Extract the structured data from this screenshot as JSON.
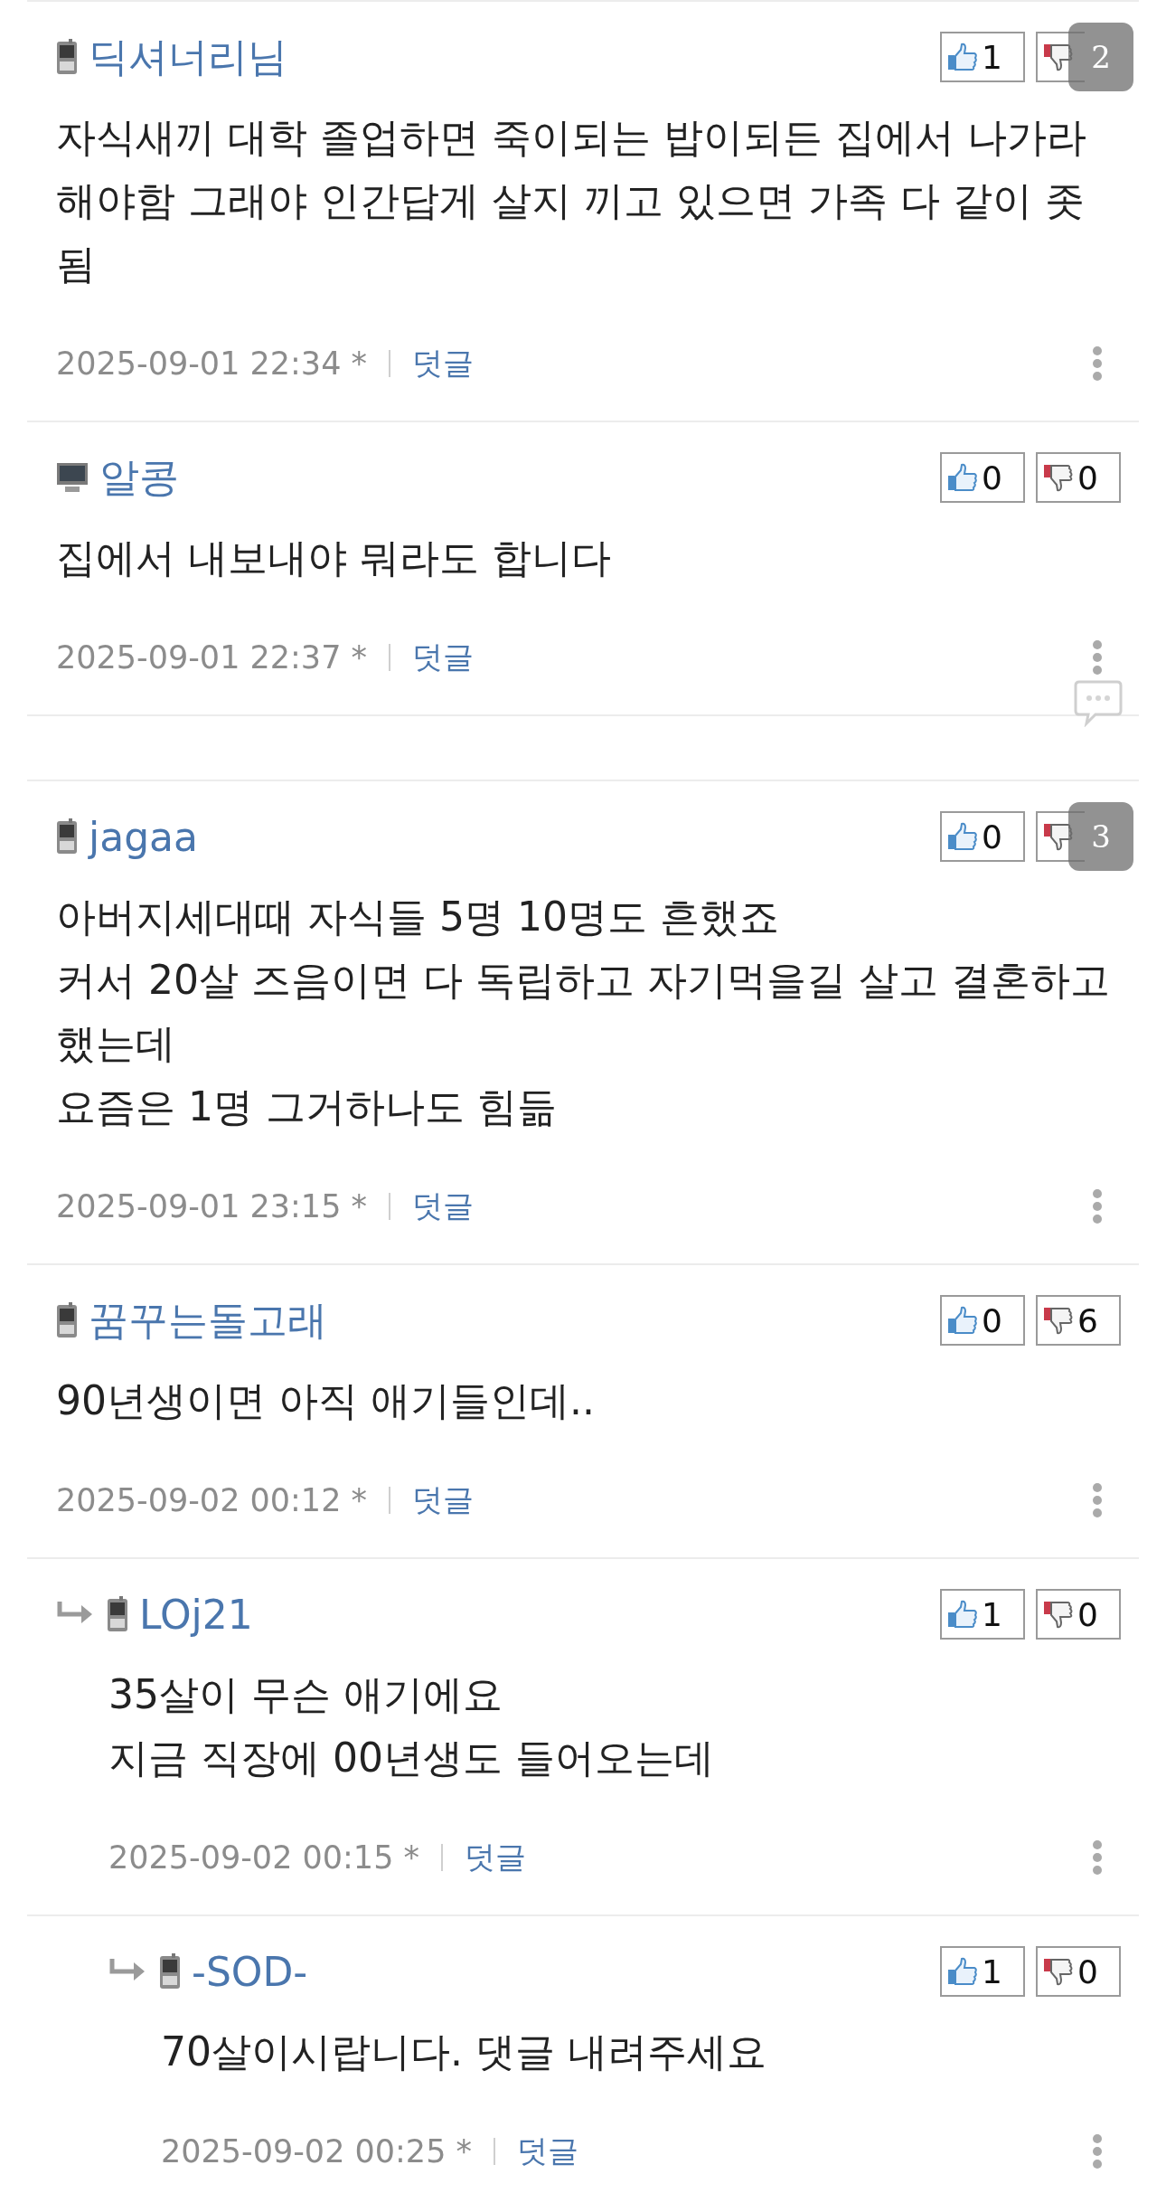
{
  "sections": [
    {
      "comments": [
        {
          "kind": "phone",
          "author": "딕셔너리님",
          "likes": "1",
          "overlay_badge": "2",
          "body": [
            "자식새끼 대학 졸업하면 죽이되는 밥이되든 집에서 나가라해야함 그래야 인간답게 살지 끼고 있으면 가족 다 같이 좃됨"
          ],
          "date": "2025-09-01 22:34 *",
          "reply_link": "덧글"
        },
        {
          "kind": "pc",
          "author": "알콩",
          "likes": "0",
          "dislikes": "0",
          "body": [
            "집에서 내보내야 뭐라도 합니다"
          ],
          "date": "2025-09-01 22:37 *",
          "reply_link": "덧글"
        }
      ]
    },
    {
      "comments": [
        {
          "kind": "phone",
          "author": "jagaa",
          "likes": "0",
          "overlay_badge": "3",
          "body": [
            "아버지세대때 자식들 5명 10명도 흔했죠",
            "커서 20살 즈음이면 다 독립하고 자기먹을길 살고 결혼하고 했는데",
            "요즘은 1명 그거하나도 힘듦"
          ],
          "date": "2025-09-01 23:15 *",
          "reply_link": "덧글"
        },
        {
          "kind": "phone",
          "author": "꿈꾸는돌고래",
          "likes": "0",
          "dislikes": "6",
          "body": [
            "90년생이면 아직 애기들인데.."
          ],
          "date": "2025-09-02 00:12 *",
          "reply_link": "덧글",
          "children": [
            {
              "kind": "phone",
              "author": "LOj21",
              "likes": "1",
              "dislikes": "0",
              "body": [
                "35살이 무슨 애기에요",
                "지금 직장에 00년생도 들어오는데"
              ],
              "date": "2025-09-02 00:15 *",
              "reply_link": "덧글",
              "children": [
                {
                  "kind": "phone",
                  "author": "-SOD-",
                  "likes": "1",
                  "dislikes": "0",
                  "body": [
                    "70살이시랍니다. 댓글 내려주세요"
                  ],
                  "date": "2025-09-02 00:25 *",
                  "reply_link": "덧글"
                }
              ]
            }
          ]
        }
      ]
    }
  ]
}
